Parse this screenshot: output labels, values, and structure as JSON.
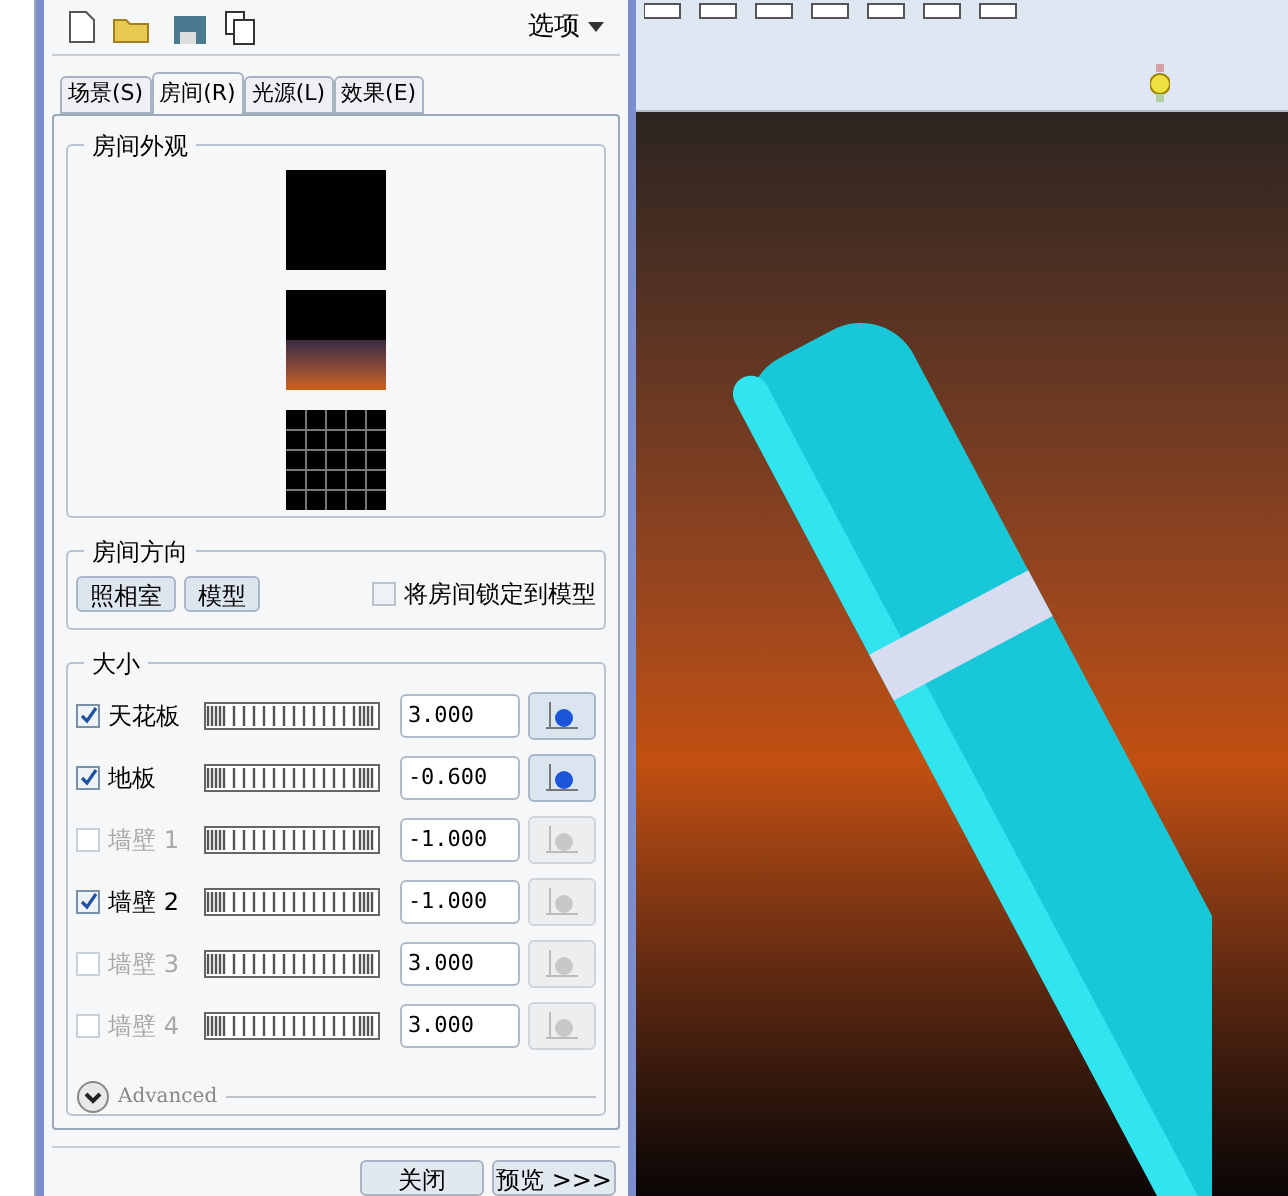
{
  "dialog": {
    "options_menu": "选项",
    "tabs": [
      {
        "label": "场景(S)",
        "selected": false
      },
      {
        "label": "房间(R)",
        "selected": true
      },
      {
        "label": "光源(L)",
        "selected": false
      },
      {
        "label": "效果(E)",
        "selected": false
      }
    ],
    "appearance": {
      "title": "房间外观"
    },
    "orientation": {
      "title": "房间方向",
      "buttons": [
        "照相室",
        "模型"
      ],
      "lock": {
        "label": "将房间锁定到模型",
        "checked": false
      }
    },
    "size": {
      "title": "大小",
      "rows": [
        {
          "label": "天花板",
          "checked": true,
          "value": "3.000",
          "button_active": true
        },
        {
          "label": "地板",
          "checked": true,
          "value": "-0.600",
          "button_active": true
        },
        {
          "label": "墙壁 1",
          "checked": false,
          "value": "-1.000",
          "button_active": false
        },
        {
          "label": "墙壁 2",
          "checked": true,
          "value": "-1.000",
          "button_active": false
        },
        {
          "label": "墙壁 3",
          "checked": false,
          "value": "3.000",
          "button_active": false
        },
        {
          "label": "墙壁 4",
          "checked": false,
          "value": "3.000",
          "button_active": false
        }
      ],
      "advanced": "Advanced"
    },
    "footer_buttons": [
      "关闭",
      "预览 >>>"
    ]
  }
}
